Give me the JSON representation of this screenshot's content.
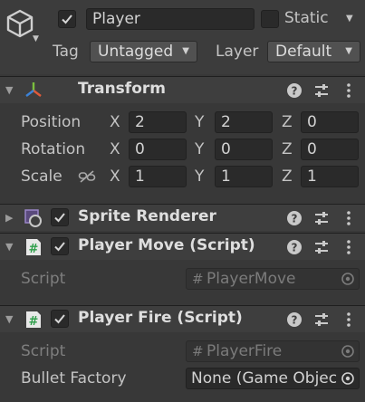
{
  "gameobject": {
    "name": "Player",
    "active": true,
    "static_label": "Static",
    "static": false,
    "tag_label": "Tag",
    "tag_value": "Untagged",
    "layer_label": "Layer",
    "layer_value": "Default"
  },
  "transform": {
    "title": "Transform",
    "position_label": "Position",
    "rotation_label": "Rotation",
    "scale_label": "Scale",
    "axis_x": "X",
    "axis_y": "Y",
    "axis_z": "Z",
    "position": {
      "x": "2",
      "y": "2",
      "z": "0"
    },
    "rotation": {
      "x": "0",
      "y": "0",
      "z": "0"
    },
    "scale": {
      "x": "1",
      "y": "1",
      "z": "1"
    }
  },
  "sprite_renderer": {
    "title": "Sprite Renderer",
    "enabled": true
  },
  "player_move": {
    "title": "Player Move (Script)",
    "enabled": true,
    "script_label": "Script",
    "script_value": "PlayerMove"
  },
  "player_fire": {
    "title": "Player Fire (Script)",
    "enabled": true,
    "script_label": "Script",
    "script_value": "PlayerFire",
    "bullet_factory_label": "Bullet Factory",
    "bullet_factory_value": "None (Game Object)"
  },
  "icons": {
    "gameobject": "cube-icon",
    "transform": "transform-axes-icon",
    "sprite_renderer": "sprite-renderer-icon",
    "script": "csharp-script-icon",
    "help": "help-icon",
    "presets": "presets-icon",
    "more": "kebab-menu-icon",
    "target": "object-picker-icon"
  },
  "colors": {
    "background": "#383838",
    "header": "#3e3e3e",
    "field": "#2a2a2a",
    "text": "#c4c4c4",
    "script_icon": "#2e9e4a"
  }
}
